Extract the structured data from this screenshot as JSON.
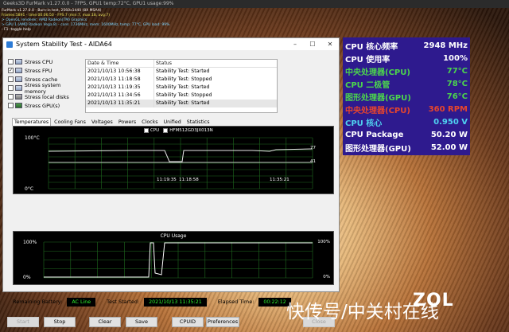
{
  "furmark": {
    "titlebar": "Geeks3D FurMark v1.27.0.0 - 7FPS, GPU1 temp:72°C, GPU1 usage:99%",
    "lines": [
      "FurMark v1.27.0.0 - Burn-in test, 2560x1440 (8X MSAA)",
      "Frames:5891 - time:00:06:50 - FPS:7 (min:7, max:18, avg:7)",
      "> OpenGL renderer: AMD Radeon(TM) Graphics",
      "> GPU 1 (AMD Radeon Vega 8) - core: 1736MHz, mem: 1600MHz, temp: 77°C, GPU load: 99%",
      "- F1: toggle help"
    ]
  },
  "aida": {
    "title": "System Stability Test - AIDA64",
    "window_buttons": [
      "–",
      "☐",
      "✕"
    ],
    "checks": [
      {
        "label": "Stress CPU",
        "checked": false,
        "icon": "cpu-icon"
      },
      {
        "label": "Stress FPU",
        "checked": true,
        "icon": "fpu-icon"
      },
      {
        "label": "Stress cache",
        "checked": false,
        "icon": "cache-icon"
      },
      {
        "label": "Stress system memory",
        "checked": false,
        "icon": "memory-icon"
      },
      {
        "label": "Stress local disks",
        "checked": false,
        "icon": "disk-icon"
      },
      {
        "label": "Stress GPU(s)",
        "checked": false,
        "icon": "gpu-icon"
      }
    ],
    "log": {
      "headers": [
        "Date & Time",
        "Status"
      ],
      "rows": [
        [
          "2021/10/13 10:56:38",
          "Stability Test: Started"
        ],
        [
          "2021/10/13 11:18:58",
          "Stability Test: Stopped"
        ],
        [
          "2021/10/13 11:19:35",
          "Stability Test: Started"
        ],
        [
          "2021/10/13 11:34:56",
          "Stability Test: Stopped"
        ],
        [
          "2021/10/13 11:35:21",
          "Stability Test: Started"
        ]
      ]
    },
    "tabs": [
      "Temperatures",
      "Cooling Fans",
      "Voltages",
      "Powers",
      "Clocks",
      "Unified",
      "Statistics"
    ],
    "temp_graph": {
      "legend": [
        {
          "label": "CPU",
          "checked": true
        },
        {
          "label": "HFM512GD3JX013N",
          "checked": true
        }
      ],
      "y_top": "100°C",
      "y_bottom": "0°C",
      "right_values": [
        "77",
        "41"
      ],
      "times": [
        "11:19:35",
        "11:18:58",
        "11:35:21"
      ]
    },
    "cpu_graph": {
      "title": "CPU Usage",
      "y_top_left": "100%",
      "y_bottom_left": "0%",
      "y_top_right": "100%",
      "y_bottom_right": "0%"
    },
    "status": {
      "battery_label": "Remaining Battery:",
      "battery_value": "AC Line",
      "started_label": "Test Started:",
      "started_value": "2021/10/13 11:35:21",
      "elapsed_label": "Elapsed Time:",
      "elapsed_value": "00:22:12"
    },
    "buttons": {
      "start": "Start",
      "stop": "Stop",
      "clear": "Clear",
      "save": "Save",
      "cpuid": "CPUID",
      "preferences": "Preferences",
      "close": "Close"
    }
  },
  "osd": [
    {
      "label": "CPU 核心频率",
      "value": "2948 MHz",
      "color": "#ffffff"
    },
    {
      "label": "CPU 使用率",
      "value": "100%",
      "color": "#ffffff"
    },
    {
      "label": "中央处理器(CPU)",
      "value": "77°C",
      "color": "#4cd64c"
    },
    {
      "label": "CPU 二极管",
      "value": "78°C",
      "color": "#4cd64c"
    },
    {
      "label": "图形处理器(GPU)",
      "value": "76°C",
      "color": "#4cd64c"
    },
    {
      "label": "中央处理器(CPU)",
      "value": "360 RPM",
      "color": "#e8452c"
    },
    {
      "label": "CPU 核心",
      "value": "0.950 V",
      "color": "#4fd2f0"
    },
    {
      "label": "CPU Package",
      "value": "50.20 W",
      "color": "#ffffff"
    },
    {
      "label": "图形处理器(GPU)",
      "value": "52.00 W",
      "color": "#ffffff"
    }
  ],
  "watermark": {
    "text": "快传号/中关村在线",
    "logo": "ZOL"
  }
}
